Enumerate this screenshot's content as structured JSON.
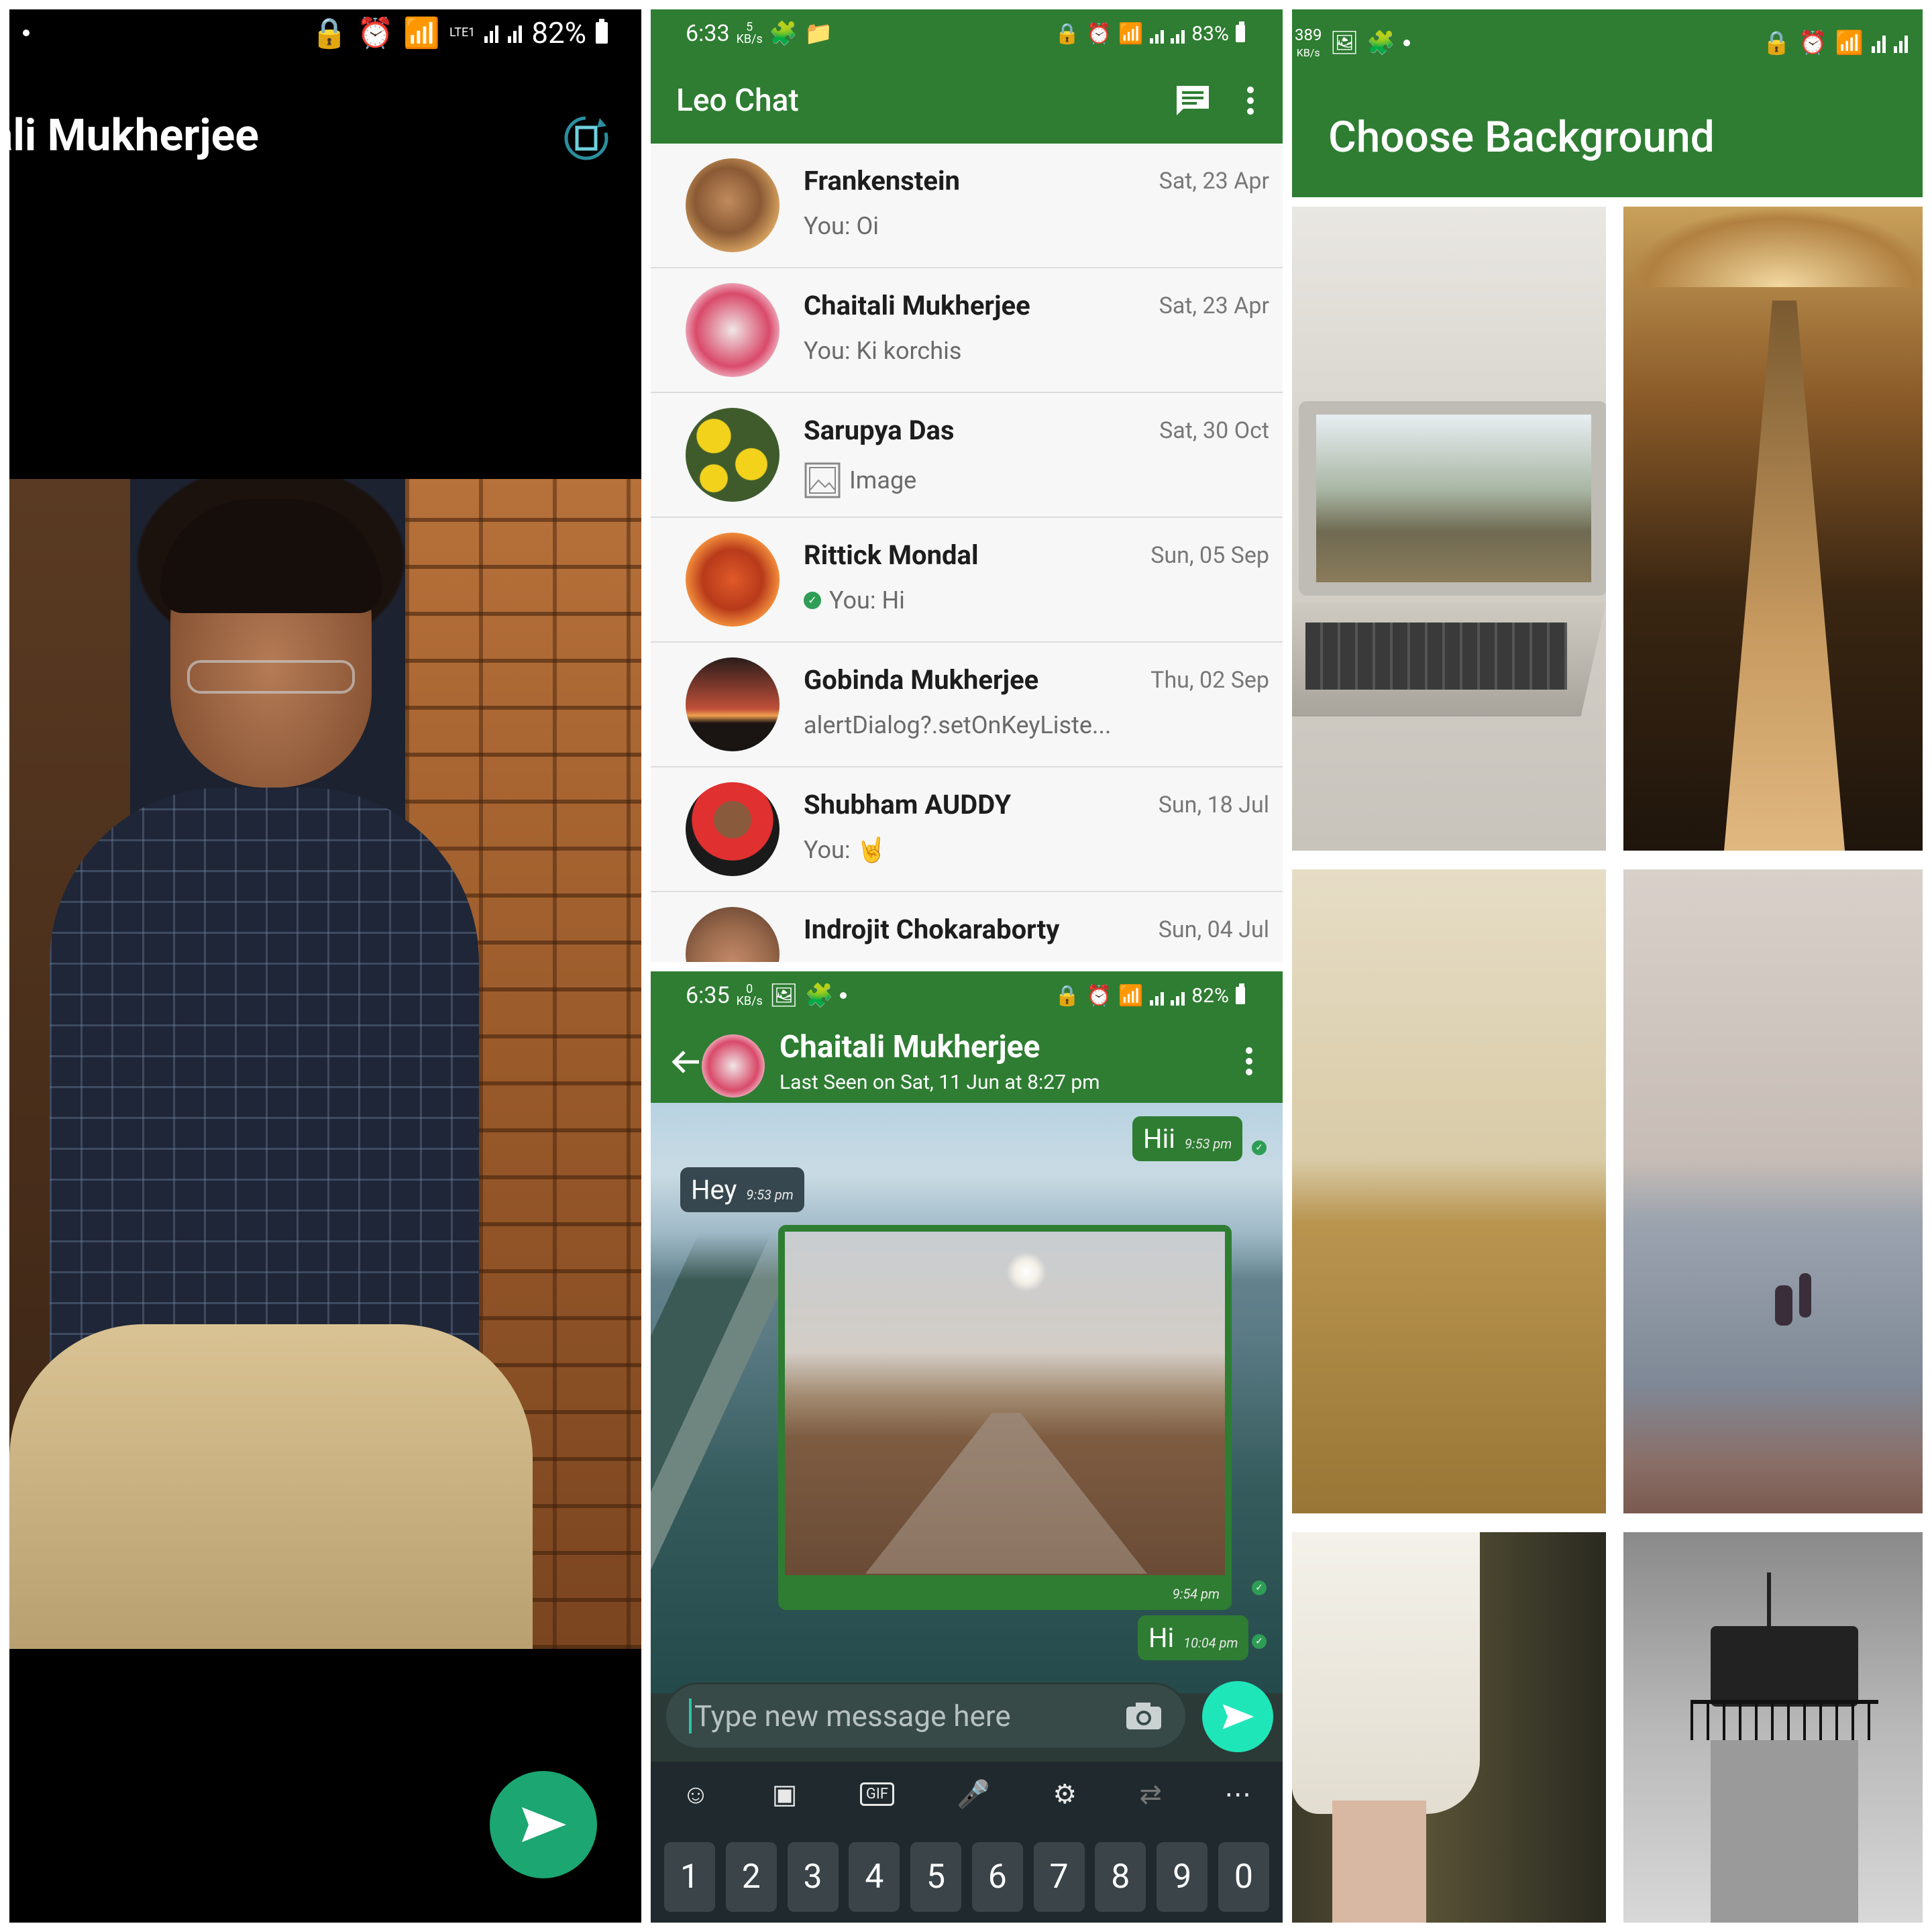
{
  "panel1": {
    "title": "ali Mukherjee",
    "status": {
      "battery": "82%",
      "lte": "LTE1"
    },
    "send_fab_icon": "send-icon",
    "rotate_icon": "rotate-icon"
  },
  "chat_list": {
    "status": {
      "time": "6:33",
      "speed": "5",
      "speed_unit": "KB/s",
      "battery": "83%"
    },
    "app_title": "Leo Chat",
    "chats": [
      {
        "name": "Frankenstein",
        "date": "Sat, 23 Apr",
        "message": "You: Oi"
      },
      {
        "name": "Chaitali Mukherjee",
        "date": "Sat, 23 Apr",
        "message": "You: Ki korchis"
      },
      {
        "name": "Sarupya Das",
        "date": "Sat, 30 Oct",
        "message": "Image"
      },
      {
        "name": "Rittick Mondal",
        "date": "Sun, 05 Sep",
        "message": "You: Hi"
      },
      {
        "name": "Gobinda Mukherjee",
        "date": "Thu, 02 Sep",
        "message": "alertDialog?.setOnKeyListe..."
      },
      {
        "name": "Shubham AUDDY",
        "date": "Sun, 18 Jul",
        "message": "You: 🤘"
      },
      {
        "name": "Indrojit Chokaraborty",
        "date": "Sun, 04 Jul",
        "message": ""
      }
    ]
  },
  "chat_screen": {
    "status": {
      "time": "6:35",
      "speed": "0",
      "speed_unit": "KB/s",
      "battery": "82%"
    },
    "contact_name": "Chaitali Mukherjee",
    "last_seen": "Last Seen on Sat, 11 Jun at 8:27 pm",
    "messages": [
      {
        "text": "Hii",
        "time": "9:53 pm",
        "side": "sent"
      },
      {
        "text": "Hey",
        "time": "9:53 pm",
        "side": "received"
      },
      {
        "text": "",
        "time": "9:54 pm",
        "side": "sent",
        "type": "image"
      },
      {
        "text": "Hi",
        "time": "10:04 pm",
        "side": "sent"
      }
    ],
    "input_placeholder": "Type new message here",
    "keys": [
      "1",
      "2",
      "3",
      "4",
      "5",
      "6",
      "7",
      "8",
      "9",
      "0"
    ]
  },
  "background_picker": {
    "status": {
      "speed": "389",
      "speed_unit": "KB/s"
    },
    "title": "Choose Background"
  },
  "colors": {
    "primary": "#2e7d32",
    "accent": "#1ee6b9",
    "fab": "#1ba672"
  }
}
